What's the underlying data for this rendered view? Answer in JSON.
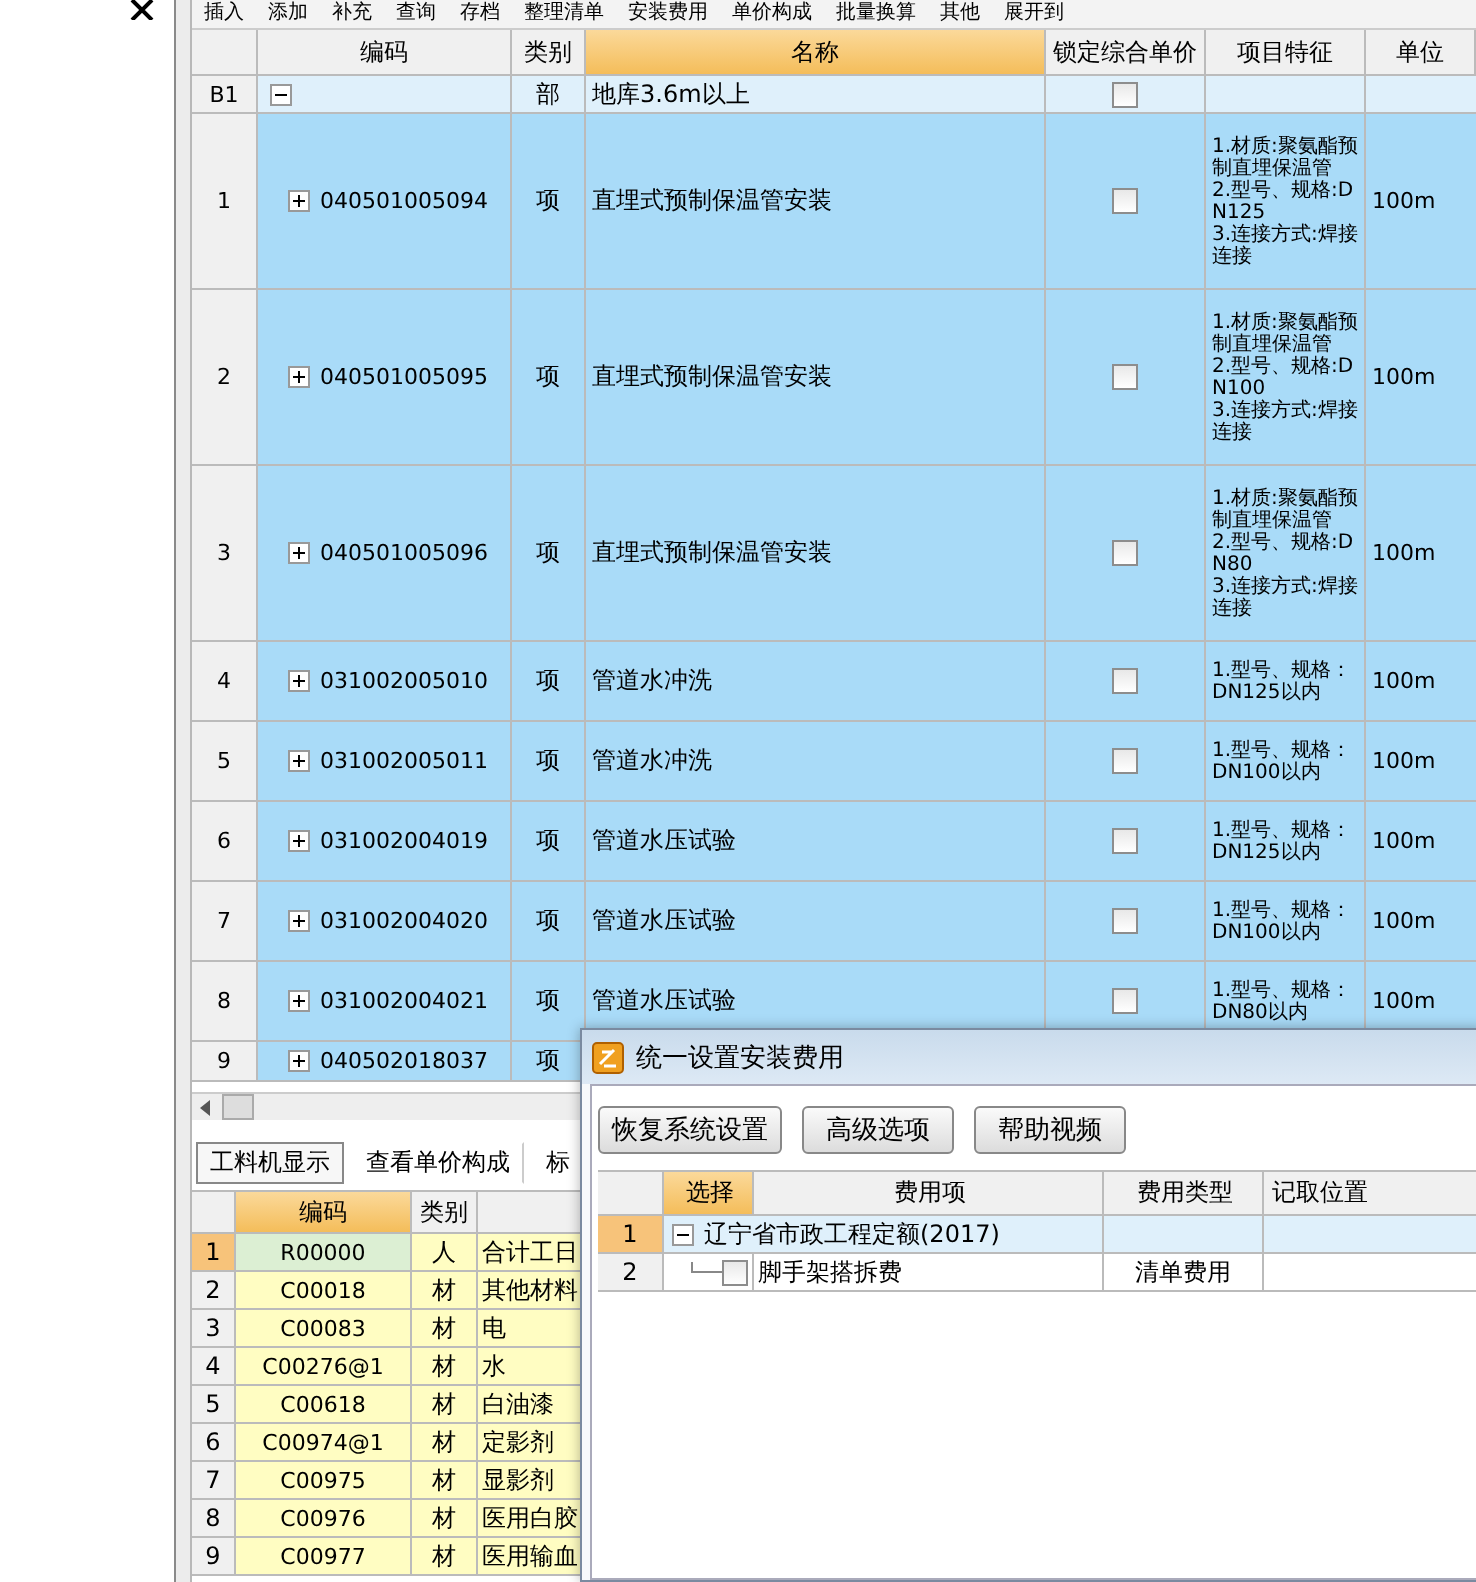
{
  "toolbar": [
    "插入",
    "添加",
    "补充",
    "查询",
    "存档",
    "整理清单",
    "安装费用",
    "单价构成",
    "批量换算",
    "其他",
    "展开到"
  ],
  "main_table": {
    "columns": [
      {
        "label": "编码",
        "selected": false
      },
      {
        "label": "类别",
        "selected": false
      },
      {
        "label": "名称",
        "selected": true
      },
      {
        "label": "锁定综合单价",
        "selected": false
      },
      {
        "label": "项目特征",
        "selected": false
      },
      {
        "label": "单位",
        "selected": false
      }
    ],
    "rows": [
      {
        "kind": "section",
        "number": "B1",
        "code": "",
        "category": "部",
        "name": "地库3.6m以上",
        "locked": false,
        "feature": "",
        "unit": "",
        "expanded": true,
        "selected": false
      },
      {
        "kind": "item",
        "number": "1",
        "code": "040501005094",
        "category": "项",
        "name": "直埋式预制保温管安装",
        "locked": false,
        "feature": "1.材质:聚氨酯预制直埋保温管\n2.型号、规格:DN125\n3.连接方式:焊接连接",
        "unit": "100m",
        "expanded": false,
        "selected": true
      },
      {
        "kind": "item",
        "number": "2",
        "code": "040501005095",
        "category": "项",
        "name": "直埋式预制保温管安装",
        "locked": false,
        "feature": "1.材质:聚氨酯预制直埋保温管\n2.型号、规格:DN100\n3.连接方式:焊接连接",
        "unit": "100m",
        "expanded": false,
        "selected": true
      },
      {
        "kind": "item",
        "number": "3",
        "code": "040501005096",
        "category": "项",
        "name": "直埋式预制保温管安装",
        "locked": false,
        "feature": "1.材质:聚氨酯预制直埋保温管\n2.型号、规格:DN80\n3.连接方式:焊接连接",
        "unit": "100m",
        "expanded": false,
        "selected": true
      },
      {
        "kind": "item",
        "number": "4",
        "code": "031002005010",
        "category": "项",
        "name": "管道水冲洗",
        "locked": false,
        "feature": "1.型号、规格：DN125以内",
        "unit": "100m",
        "expanded": false,
        "selected": true
      },
      {
        "kind": "item",
        "number": "5",
        "code": "031002005011",
        "category": "项",
        "name": "管道水冲洗",
        "locked": false,
        "feature": "1.型号、规格：DN100以内",
        "unit": "100m",
        "expanded": false,
        "selected": true
      },
      {
        "kind": "item",
        "number": "6",
        "code": "031002004019",
        "category": "项",
        "name": "管道水压试验",
        "locked": false,
        "feature": "1.型号、规格：DN125以内",
        "unit": "100m",
        "expanded": false,
        "selected": true
      },
      {
        "kind": "item",
        "number": "7",
        "code": "031002004020",
        "category": "项",
        "name": "管道水压试验",
        "locked": false,
        "feature": "1.型号、规格：DN100以内",
        "unit": "100m",
        "expanded": false,
        "selected": true
      },
      {
        "kind": "item",
        "number": "8",
        "code": "031002004021",
        "category": "项",
        "name": "管道水压试验",
        "locked": false,
        "feature": "1.型号、规格：DN80以内",
        "unit": "100m",
        "expanded": false,
        "selected": true
      },
      {
        "kind": "item",
        "number": "9",
        "code": "040502018037",
        "category": "项",
        "name": "",
        "feature": "",
        "unit": "",
        "expanded": false,
        "selected": true
      }
    ]
  },
  "bottom_tabs": [
    {
      "label": "工料机显示",
      "selected": true
    },
    {
      "label": "查看单价构成",
      "selected": false
    },
    {
      "label": "标",
      "selected": false
    }
  ],
  "resource_table": {
    "columns": [
      "编码",
      "类别"
    ],
    "rows": [
      {
        "number": "1",
        "code": "R00000",
        "category": "人",
        "name": "合计工日",
        "selected": true
      },
      {
        "number": "2",
        "code": "C00018",
        "category": "材",
        "name": "其他材料",
        "selected": false
      },
      {
        "number": "3",
        "code": "C00083",
        "category": "材",
        "name": "电",
        "selected": false
      },
      {
        "number": "4",
        "code": "C00276@1",
        "category": "材",
        "name": "水",
        "selected": false
      },
      {
        "number": "5",
        "code": "C00618",
        "category": "材",
        "name": "白油漆",
        "selected": false
      },
      {
        "number": "6",
        "code": "C00974@1",
        "category": "材",
        "name": "定影剂",
        "selected": false
      },
      {
        "number": "7",
        "code": "C00975",
        "category": "材",
        "name": "显影剂",
        "selected": false
      },
      {
        "number": "8",
        "code": "C00976",
        "category": "材",
        "name": "医用白胶",
        "selected": false
      },
      {
        "number": "9",
        "code": "C00977",
        "category": "材",
        "name": "医用输血",
        "selected": false
      }
    ]
  },
  "dialog": {
    "title": "统一设置安装费用",
    "buttons": [
      "恢复系统设置",
      "高级选项",
      "帮助视频"
    ],
    "columns": [
      {
        "label": "选择",
        "selected": true
      },
      {
        "label": "费用项",
        "selected": false
      },
      {
        "label": "费用类型",
        "selected": false
      },
      {
        "label": "记取位置",
        "selected": false
      }
    ],
    "rows": [
      {
        "kind": "group",
        "number": "1",
        "label": "辽宁省市政工程定额(2017)",
        "expanded": true,
        "type": "",
        "position": "",
        "selected": true
      },
      {
        "kind": "option",
        "number": "2",
        "label": "脚手架搭拆费",
        "checked": false,
        "type": "清单费用",
        "position": "",
        "selected": false
      }
    ]
  }
}
